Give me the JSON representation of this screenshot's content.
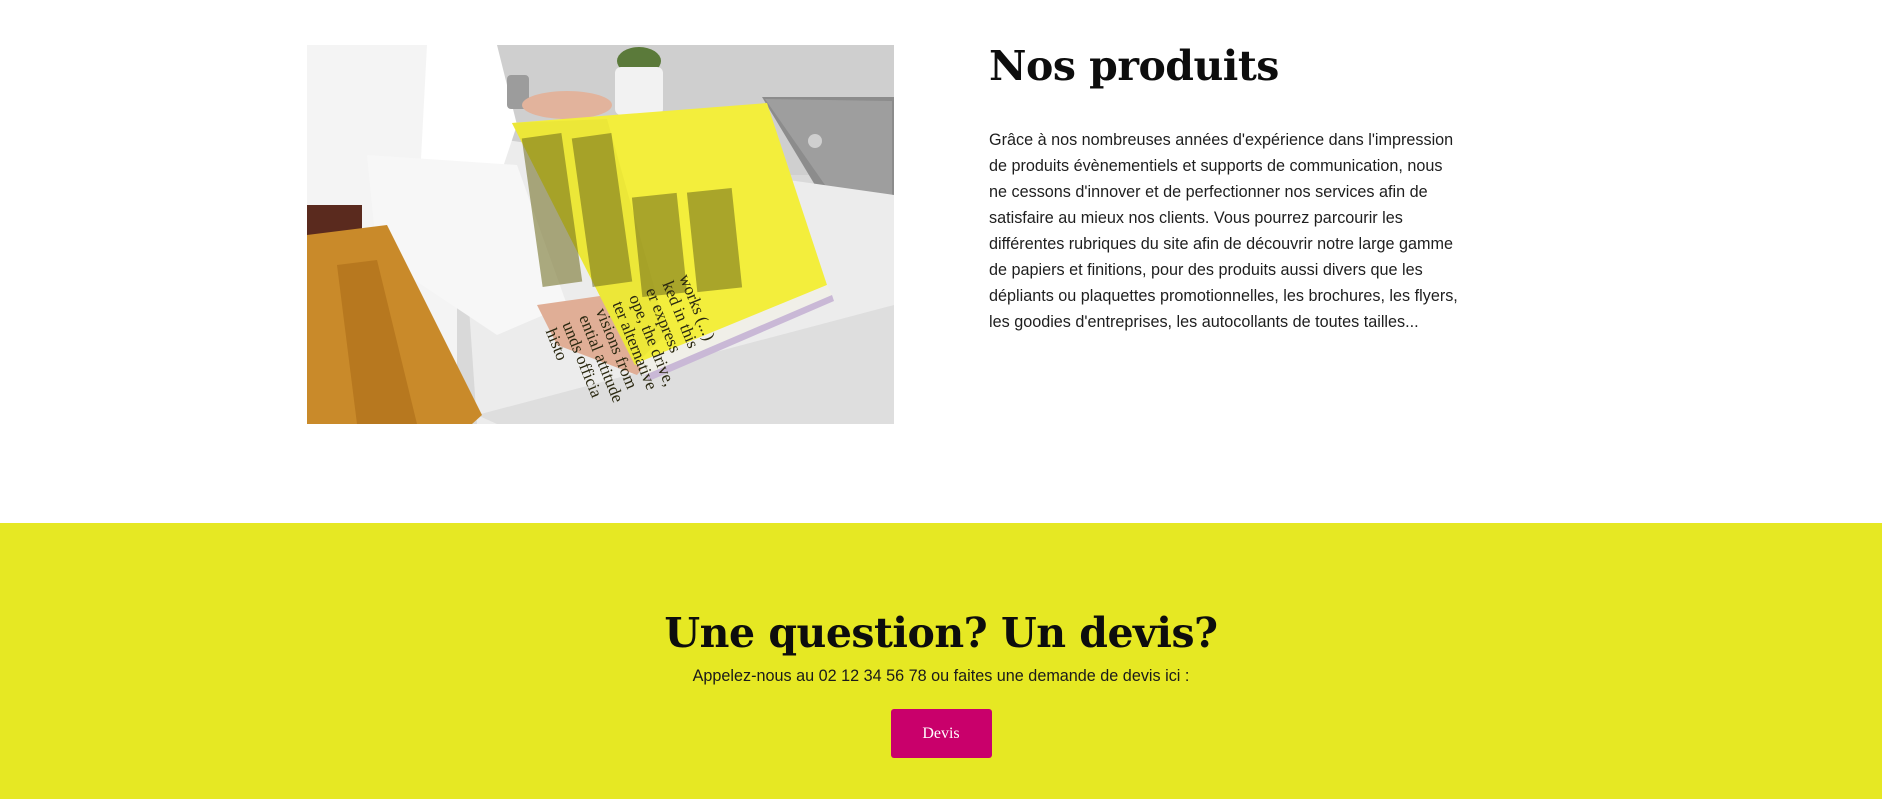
{
  "products_section": {
    "heading": "Nos produits",
    "paragraph": "Grâce à nos nombreuses années d'expérience dans l'impression de produits évènementiels et supports de communication, nous ne cessons d'innover et de perfectionner nos services afin de satisfaire au mieux nos clients. Vous pourrez parcourir les différentes rubriques du site afin de découvrir notre large gamme de papiers et finitions, pour des produits aussi divers que les dépliants ou plaquettes promotionnelles, les brochures, les flyers, les goodies d'entreprises, les autocollants de toutes tailles...",
    "image_icon": "photo-person-reading-yellow-magazine",
    "magazine_text": [
      "works (...)",
      "ked in this",
      "er express",
      "ope, the drive,",
      "ter alternative",
      "visions from",
      "ential attitude",
      "unds officia",
      "histo"
    ]
  },
  "cta_section": {
    "title": "Une question? Un devis?",
    "text": "Appelez-nous au 02 12 34 56 78 ou faites une demande de devis ici :",
    "button_label": "Devis"
  },
  "colors": {
    "cta_background": "#e6e823",
    "button_background": "#c9006b",
    "button_text": "#ffffff"
  }
}
